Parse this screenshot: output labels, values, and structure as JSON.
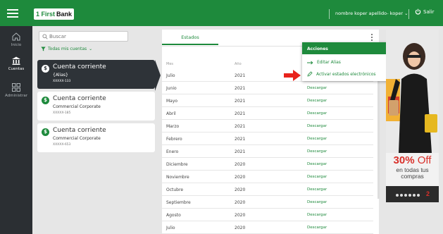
{
  "header": {
    "logo_part1": "1 First",
    "logo_part2": "Bank",
    "user_label": "nombre koper apellido- koper",
    "logout_label": "Salir"
  },
  "sidebar": {
    "items": [
      {
        "label": "Inicio",
        "icon": "home-icon"
      },
      {
        "label": "Cuentas",
        "icon": "bank-icon"
      },
      {
        "label": "Administrar",
        "icon": "grid-icon"
      }
    ]
  },
  "accounts_panel": {
    "search_placeholder": "Buscar",
    "filter_label": "Todas mis cuentas",
    "accounts": [
      {
        "title": "Cuenta corriente",
        "subtitle": "{Alias}",
        "number": "XXXXX-133",
        "selected": true
      },
      {
        "title": "Cuenta corriente",
        "subtitle": "Commercial Corporate",
        "number": "XXXXX-185",
        "selected": false
      },
      {
        "title": "Cuenta corriente",
        "subtitle": "Commercial Corporate",
        "number": "XXXXX-653",
        "selected": false
      }
    ]
  },
  "main": {
    "tab_label": "Estados",
    "columns": [
      "Mes",
      "Año",
      ""
    ],
    "rows": [
      {
        "month": "Julio",
        "year": "2021",
        "action": ""
      },
      {
        "month": "Junio",
        "year": "2021",
        "action": "Descargar"
      },
      {
        "month": "Mayo",
        "year": "2021",
        "action": "Descargar"
      },
      {
        "month": "Abril",
        "year": "2021",
        "action": "Descargar"
      },
      {
        "month": "Marzo",
        "year": "2021",
        "action": "Descargar"
      },
      {
        "month": "Febrero",
        "year": "2021",
        "action": "Descargar"
      },
      {
        "month": "Enero",
        "year": "2021",
        "action": "Descargar"
      },
      {
        "month": "Diciembre",
        "year": "2020",
        "action": "Descargar"
      },
      {
        "month": "Noviembre",
        "year": "2020",
        "action": "Descargar"
      },
      {
        "month": "Octubre",
        "year": "2020",
        "action": "Descargar"
      },
      {
        "month": "Septiembre",
        "year": "2020",
        "action": "Descargar"
      },
      {
        "month": "Agosto",
        "year": "2020",
        "action": "Descargar"
      },
      {
        "month": "Julio",
        "year": "2020",
        "action": "Descargar"
      }
    ]
  },
  "actions_menu": {
    "title": "Acciones",
    "items": [
      {
        "label": "Editar Alias",
        "icon": "arrow-right-icon"
      },
      {
        "label": "Activar estados electrónicos",
        "icon": "pencil-icon"
      }
    ]
  },
  "ad": {
    "percent": "30%",
    "off": "Off",
    "line1": "en todas tus",
    "line2": "compras",
    "page_number": "2"
  },
  "colors": {
    "brand_green": "#1e8a3c",
    "sidebar_dark": "#2b2f33",
    "highlight_red": "#e8231c"
  }
}
